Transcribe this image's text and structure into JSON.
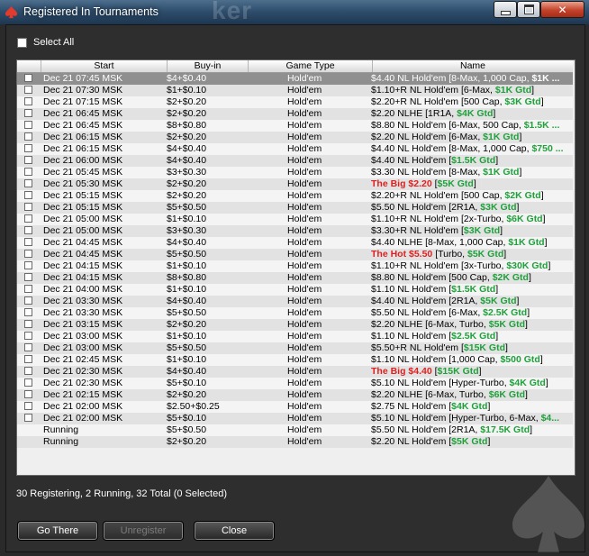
{
  "window": {
    "title": "Registered In Tournaments",
    "brand_text": "ker"
  },
  "select_all": {
    "label": "Select All"
  },
  "columns": {
    "start": "Start",
    "buyin": "Buy-in",
    "game_type": "Game Type",
    "name": "Name"
  },
  "rows": [
    {
      "start": "Dec 21  07:45 MSK",
      "buyin": "$4+$0.40",
      "game": "Hold'em",
      "name": [
        [
          "$4.40 NL Hold'em [8-Max, 1,000 Cap, ",
          ""
        ],
        [
          "$1K ...",
          "bld"
        ]
      ],
      "selected": true,
      "checkbox": true
    },
    {
      "start": "Dec 21  07:30 MSK",
      "buyin": "$1+$0.10",
      "game": "Hold'em",
      "name": [
        [
          "$1.10+R NL Hold'em [6-Max, ",
          ""
        ],
        [
          "$1K Gtd",
          "grn"
        ],
        [
          "]",
          ""
        ]
      ],
      "checkbox": true
    },
    {
      "start": "Dec 21  07:15 MSK",
      "buyin": "$2+$0.20",
      "game": "Hold'em",
      "name": [
        [
          "$2.20+R NL Hold'em [500 Cap, ",
          ""
        ],
        [
          "$3K Gtd",
          "grn"
        ],
        [
          "]",
          ""
        ]
      ],
      "checkbox": true
    },
    {
      "start": "Dec 21  06:45 MSK",
      "buyin": "$2+$0.20",
      "game": "Hold'em",
      "name": [
        [
          "$2.20 NLHE [1R1A, ",
          ""
        ],
        [
          "$4K Gtd",
          "grn"
        ],
        [
          "]",
          ""
        ]
      ],
      "checkbox": true
    },
    {
      "start": "Dec 21  06:45 MSK",
      "buyin": "$8+$0.80",
      "game": "Hold'em",
      "name": [
        [
          "$8.80 NL Hold'em [6-Max, 500 Cap, ",
          ""
        ],
        [
          "$1.5K ...",
          "grn"
        ]
      ],
      "checkbox": true
    },
    {
      "start": "Dec 21  06:15 MSK",
      "buyin": "$2+$0.20",
      "game": "Hold'em",
      "name": [
        [
          "$2.20 NL Hold'em [6-Max, ",
          ""
        ],
        [
          "$1K Gtd",
          "grn"
        ],
        [
          "]",
          ""
        ]
      ],
      "checkbox": true
    },
    {
      "start": "Dec 21  06:15 MSK",
      "buyin": "$4+$0.40",
      "game": "Hold'em",
      "name": [
        [
          "$4.40 NL Hold'em [8-Max, 1,000 Cap, ",
          ""
        ],
        [
          "$750 ...",
          "grn"
        ]
      ],
      "checkbox": true
    },
    {
      "start": "Dec 21  06:00 MSK",
      "buyin": "$4+$0.40",
      "game": "Hold'em",
      "name": [
        [
          "$4.40 NL Hold'em [",
          ""
        ],
        [
          "$1.5K Gtd",
          "grn"
        ],
        [
          "]",
          ""
        ]
      ],
      "checkbox": true
    },
    {
      "start": "Dec 21  05:45 MSK",
      "buyin": "$3+$0.30",
      "game": "Hold'em",
      "name": [
        [
          "$3.30 NL Hold'em [8-Max, ",
          ""
        ],
        [
          "$1K Gtd",
          "grn"
        ],
        [
          "]",
          ""
        ]
      ],
      "checkbox": true
    },
    {
      "start": "Dec 21  05:30 MSK",
      "buyin": "$2+$0.20",
      "game": "Hold'em",
      "name": [
        [
          "The Big $2.20",
          "red"
        ],
        [
          " [",
          ""
        ],
        [
          "$5K Gtd",
          "grn"
        ],
        [
          "]",
          ""
        ]
      ],
      "checkbox": true
    },
    {
      "start": "Dec 21  05:15 MSK",
      "buyin": "$2+$0.20",
      "game": "Hold'em",
      "name": [
        [
          "$2.20+R NL Hold'em [500 Cap, ",
          ""
        ],
        [
          "$2K Gtd",
          "grn"
        ],
        [
          "]",
          ""
        ]
      ],
      "checkbox": true
    },
    {
      "start": "Dec 21  05:15 MSK",
      "buyin": "$5+$0.50",
      "game": "Hold'em",
      "name": [
        [
          "$5.50 NL Hold'em [2R1A, ",
          ""
        ],
        [
          "$3K Gtd",
          "grn"
        ],
        [
          "]",
          ""
        ]
      ],
      "checkbox": true
    },
    {
      "start": "Dec 21  05:00 MSK",
      "buyin": "$1+$0.10",
      "game": "Hold'em",
      "name": [
        [
          "$1.10+R NL Hold'em [2x-Turbo, ",
          ""
        ],
        [
          "$6K Gtd",
          "grn"
        ],
        [
          "]",
          ""
        ]
      ],
      "checkbox": true
    },
    {
      "start": "Dec 21  05:00 MSK",
      "buyin": "$3+$0.30",
      "game": "Hold'em",
      "name": [
        [
          "$3.30+R NL Hold'em [",
          ""
        ],
        [
          "$3K Gtd",
          "grn"
        ],
        [
          "]",
          ""
        ]
      ],
      "checkbox": true
    },
    {
      "start": "Dec 21  04:45 MSK",
      "buyin": "$4+$0.40",
      "game": "Hold'em",
      "name": [
        [
          "$4.40 NLHE [8-Max, 1,000 Cap, ",
          ""
        ],
        [
          "$1K Gtd",
          "grn"
        ],
        [
          "]",
          ""
        ]
      ],
      "checkbox": true
    },
    {
      "start": "Dec 21  04:45 MSK",
      "buyin": "$5+$0.50",
      "game": "Hold'em",
      "name": [
        [
          "The Hot $5.50",
          "red"
        ],
        [
          " [Turbo, ",
          ""
        ],
        [
          "$5K Gtd",
          "grn"
        ],
        [
          "]",
          ""
        ]
      ],
      "checkbox": true
    },
    {
      "start": "Dec 21  04:15 MSK",
      "buyin": "$1+$0.10",
      "game": "Hold'em",
      "name": [
        [
          "$1.10+R NL Hold'em [3x-Turbo, ",
          ""
        ],
        [
          "$30K Gtd",
          "grn"
        ],
        [
          "]",
          ""
        ]
      ],
      "checkbox": true
    },
    {
      "start": "Dec 21  04:15 MSK",
      "buyin": "$8+$0.80",
      "game": "Hold'em",
      "name": [
        [
          "$8.80 NL Hold'em [500 Cap, ",
          ""
        ],
        [
          "$2K Gtd",
          "grn"
        ],
        [
          "]",
          ""
        ]
      ],
      "checkbox": true
    },
    {
      "start": "Dec 21  04:00 MSK",
      "buyin": "$1+$0.10",
      "game": "Hold'em",
      "name": [
        [
          "$1.10 NL Hold'em [",
          ""
        ],
        [
          "$1.5K Gtd",
          "grn"
        ],
        [
          "]",
          ""
        ]
      ],
      "checkbox": true
    },
    {
      "start": "Dec 21  03:30 MSK",
      "buyin": "$4+$0.40",
      "game": "Hold'em",
      "name": [
        [
          "$4.40 NL Hold'em [2R1A, ",
          ""
        ],
        [
          "$5K Gtd",
          "grn"
        ],
        [
          "]",
          ""
        ]
      ],
      "checkbox": true
    },
    {
      "start": "Dec 21  03:30 MSK",
      "buyin": "$5+$0.50",
      "game": "Hold'em",
      "name": [
        [
          "$5.50 NL Hold'em [6-Max, ",
          ""
        ],
        [
          "$2.5K Gtd",
          "grn"
        ],
        [
          "]",
          ""
        ]
      ],
      "checkbox": true
    },
    {
      "start": "Dec 21  03:15 MSK",
      "buyin": "$2+$0.20",
      "game": "Hold'em",
      "name": [
        [
          "$2.20 NLHE [6-Max, Turbo, ",
          ""
        ],
        [
          "$5K Gtd",
          "grn"
        ],
        [
          "]",
          ""
        ]
      ],
      "checkbox": true
    },
    {
      "start": "Dec 21  03:00 MSK",
      "buyin": "$1+$0.10",
      "game": "Hold'em",
      "name": [
        [
          "$1.10 NL Hold'em [",
          ""
        ],
        [
          "$2.5K Gtd",
          "grn"
        ],
        [
          "]",
          ""
        ]
      ],
      "checkbox": true
    },
    {
      "start": "Dec 21  03:00 MSK",
      "buyin": "$5+$0.50",
      "game": "Hold'em",
      "name": [
        [
          "$5.50+R NL Hold'em [",
          ""
        ],
        [
          "$15K Gtd",
          "grn"
        ],
        [
          "]",
          ""
        ]
      ],
      "checkbox": true
    },
    {
      "start": "Dec 21  02:45 MSK",
      "buyin": "$1+$0.10",
      "game": "Hold'em",
      "name": [
        [
          "$1.10 NL Hold'em [1,000 Cap, ",
          ""
        ],
        [
          "$500 Gtd",
          "grn"
        ],
        [
          "]",
          ""
        ]
      ],
      "checkbox": true
    },
    {
      "start": "Dec 21  02:30 MSK",
      "buyin": "$4+$0.40",
      "game": "Hold'em",
      "name": [
        [
          "The Big $4.40",
          "red"
        ],
        [
          " [",
          ""
        ],
        [
          "$15K Gtd",
          "grn"
        ],
        [
          "]",
          ""
        ]
      ],
      "checkbox": true
    },
    {
      "start": "Dec 21  02:30 MSK",
      "buyin": "$5+$0.10",
      "game": "Hold'em",
      "name": [
        [
          "$5.10 NL Hold'em [Hyper-Turbo, ",
          ""
        ],
        [
          "$4K Gtd",
          "grn"
        ],
        [
          "]",
          ""
        ]
      ],
      "checkbox": true
    },
    {
      "start": "Dec 21  02:15 MSK",
      "buyin": "$2+$0.20",
      "game": "Hold'em",
      "name": [
        [
          "$2.20 NLHE [6-Max, Turbo, ",
          ""
        ],
        [
          "$6K Gtd",
          "grn"
        ],
        [
          "]",
          ""
        ]
      ],
      "checkbox": true
    },
    {
      "start": "Dec 21  02:00 MSK",
      "buyin": "$2.50+$0.25",
      "game": "Hold'em",
      "name": [
        [
          "$2.75 NL Hold'em [",
          ""
        ],
        [
          "$4K Gtd",
          "grn"
        ],
        [
          "]",
          ""
        ]
      ],
      "checkbox": true
    },
    {
      "start": "Dec 21  02:00 MSK",
      "buyin": "$5+$0.10",
      "game": "Hold'em",
      "name": [
        [
          "$5.10 NL Hold'em [Hyper-Turbo, 6-Max, ",
          ""
        ],
        [
          "$4...",
          "grn"
        ]
      ],
      "checkbox": true
    },
    {
      "start": "Running",
      "buyin": "$5+$0.50",
      "game": "Hold'em",
      "name": [
        [
          "$5.50 NL Hold'em [2R1A, ",
          ""
        ],
        [
          "$17.5K Gtd",
          "grn"
        ],
        [
          "]",
          ""
        ]
      ],
      "checkbox": false
    },
    {
      "start": "Running",
      "buyin": "$2+$0.20",
      "game": "Hold'em",
      "name": [
        [
          "$2.20 NL Hold'em [",
          ""
        ],
        [
          "$5K Gtd",
          "grn"
        ],
        [
          "]",
          ""
        ]
      ],
      "checkbox": false
    }
  ],
  "status": "30 Registering, 2 Running, 32 Total (0 Selected)",
  "buttons": {
    "go_there": "Go There",
    "unregister": "Unregister",
    "close": "Close"
  }
}
